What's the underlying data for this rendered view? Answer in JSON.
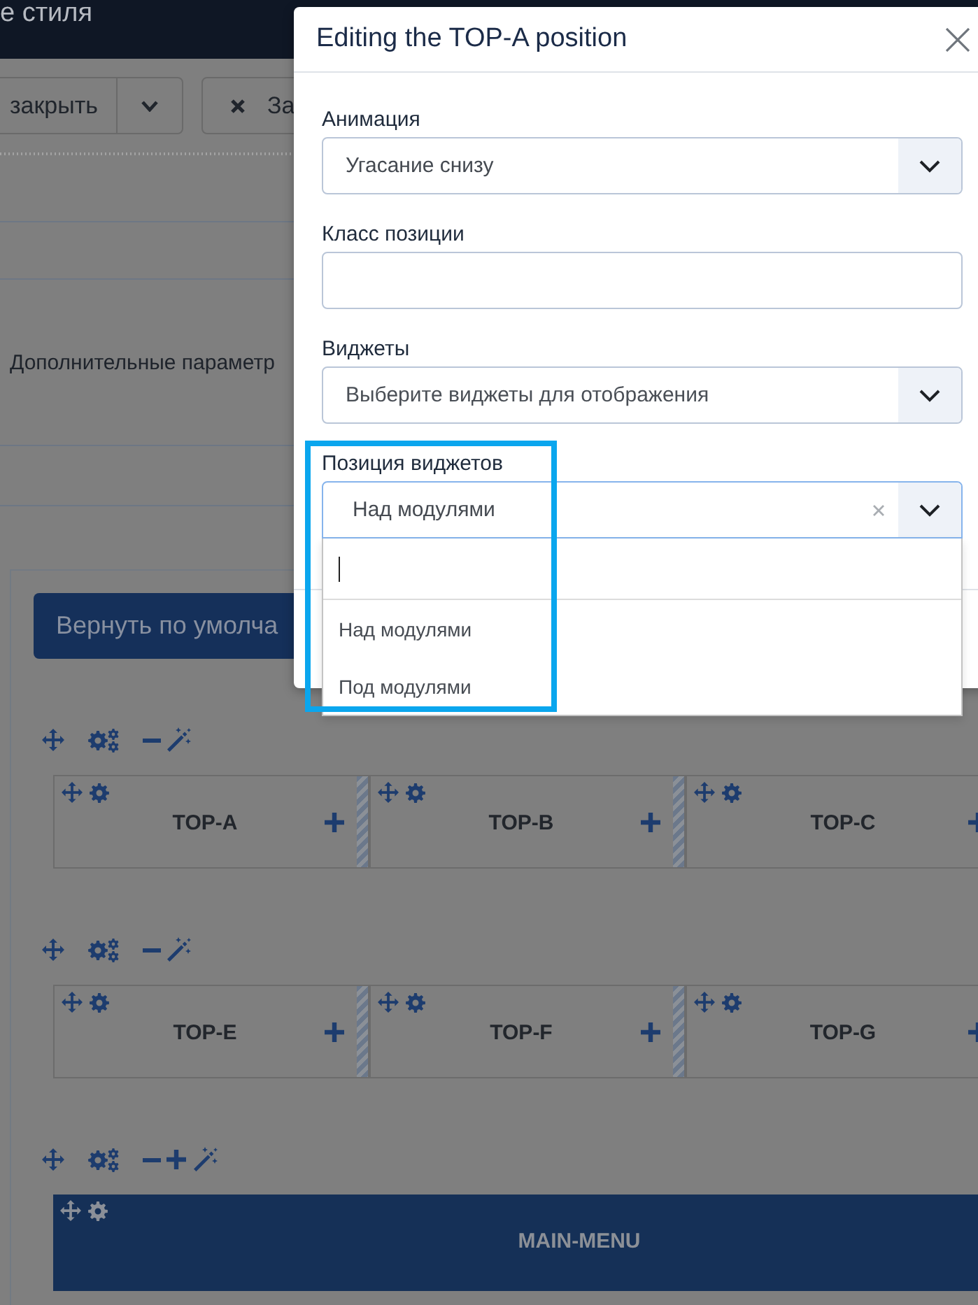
{
  "header": {
    "title": "е стиля"
  },
  "toolbar": {
    "buttons": [
      {
        "kind": "split",
        "label": "закрыть"
      },
      {
        "kind": "close",
        "label": "За"
      }
    ]
  },
  "sections": [
    {
      "label": "Дополнительные параметр"
    }
  ],
  "layout": {
    "reset_button": "Вернуть по умолча",
    "rows": [
      {
        "kind": "columns",
        "addable": false,
        "positions": [
          {
            "name": "TOP-A"
          },
          {
            "name": "TOP-B"
          },
          {
            "name": "TOP-C"
          }
        ]
      },
      {
        "kind": "columns",
        "addable": false,
        "positions": [
          {
            "name": "TOP-E"
          },
          {
            "name": "TOP-F"
          },
          {
            "name": "TOP-G"
          }
        ]
      },
      {
        "kind": "bar",
        "addable": true,
        "positions": [
          {
            "name": "MAIN-MENU"
          }
        ]
      }
    ]
  },
  "modal": {
    "title": "Editing the TOP-A position",
    "fields": [
      {
        "kind": "select",
        "label": "Анимация",
        "value": "Угасание снизу",
        "expanded": false,
        "clearable": false,
        "highlighted": false
      },
      {
        "kind": "text",
        "label": "Класс позиции",
        "expanded": false,
        "clearable": false,
        "highlighted": false
      },
      {
        "kind": "select",
        "label": "Виджеты",
        "placeholder": "Выберите виджеты для отображения",
        "expanded": false,
        "clearable": false,
        "highlighted": false
      },
      {
        "kind": "select",
        "label": "Позиция виджетов",
        "value": "Над модулями",
        "expanded": true,
        "clearable": true,
        "highlighted": true,
        "options": [
          "Над модулями",
          "Под модулями"
        ]
      }
    ]
  }
}
